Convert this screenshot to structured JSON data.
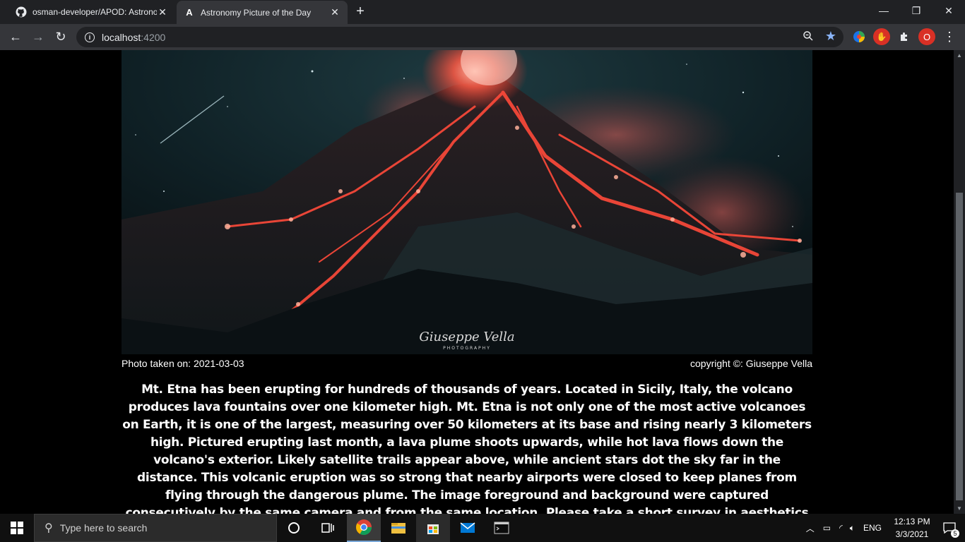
{
  "browser": {
    "tabs": [
      {
        "title": "osman-developer/APOD: Astronomy",
        "active": false
      },
      {
        "title": "Astronomy Picture of the Day",
        "active": true
      }
    ],
    "url_host": "localhost",
    "url_port": ":4200",
    "profile_initial": "O"
  },
  "apod": {
    "date_caption": "Photo taken on: 2021-03-03",
    "copyright_caption": "copyright ©: Giuseppe Vella",
    "explanation": "Mt. Etna has been erupting for hundreds of thousands of years. Located in Sicily, Italy, the volcano produces lava fountains over one kilometer high. Mt. Etna is not only one of the most active volcanoes on Earth, it is one of the largest, measuring over 50 kilometers at its base and rising nearly 3 kilometers high. Pictured erupting last month, a lava plume shoots upwards, while hot lava flows down the volcano's exterior. Likely satellite trails appear above, while ancient stars dot the sky far in the distance. This volcanic eruption was so strong that nearby airports were closed to keep planes from flying through the dangerous plume. The image foreground and background were captured consecutively by the same camera and from the same location. Please take a short survey in aesthetics & astronomy: Sonification",
    "watermark": "Giuseppe Vella PHOTOGRAPHY"
  },
  "taskbar": {
    "search_placeholder": "Type here to search",
    "language": "ENG",
    "time": "12:13 PM",
    "date": "3/3/2021",
    "notification_count": "5"
  }
}
